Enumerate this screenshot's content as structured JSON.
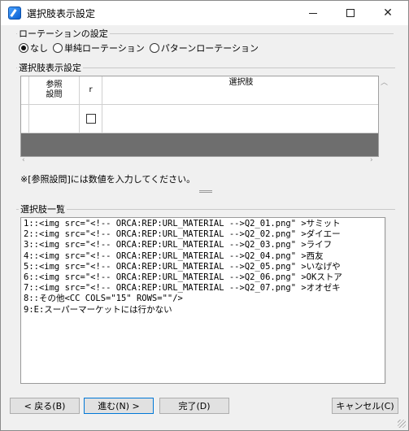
{
  "window": {
    "title": "選択肢表示設定",
    "controls": [
      "minimize-icon",
      "maximize-icon",
      "close-icon"
    ]
  },
  "rotation": {
    "label": "ローテーションの設定",
    "options": [
      {
        "label": "なし",
        "checked": true
      },
      {
        "label": "単純ローテーション",
        "checked": false
      },
      {
        "label": "パターンローテーション",
        "checked": false
      }
    ]
  },
  "choice_display": {
    "label": "選択肢表示設定",
    "columns": {
      "ref": "参照\n設問",
      "r": "r",
      "choice": "選択肢"
    },
    "rows": [
      {
        "ref": "",
        "r_checked": false,
        "choice": ""
      }
    ],
    "note": "※[参照設問]には数値を入力してください。"
  },
  "choice_list": {
    "label": "選択肢一覧",
    "lines": [
      "1::<img src=\"<!-- ORCA:REP:URL_MATERIAL -->Q2_01.png\" >サミット",
      "2::<img src=\"<!-- ORCA:REP:URL_MATERIAL -->Q2_02.png\" >ダイエー",
      "3::<img src=\"<!-- ORCA:REP:URL_MATERIAL -->Q2_03.png\" >ライフ",
      "4::<img src=\"<!-- ORCA:REP:URL_MATERIAL -->Q2_04.png\" >西友",
      "5::<img src=\"<!-- ORCA:REP:URL_MATERIAL -->Q2_05.png\" >いなげや",
      "6::<img src=\"<!-- ORCA:REP:URL_MATERIAL -->Q2_06.png\" >OKストア",
      "7::<img src=\"<!-- ORCA:REP:URL_MATERIAL -->Q2_07.png\" >オオゼキ",
      "8::その他<CC COLS=\"15\" ROWS=\"\"/>",
      "9:E:スーパーマーケットには行かない"
    ]
  },
  "buttons": {
    "back": "< 戻る(B)",
    "next": "進む(N) >",
    "done": "完了(D)",
    "cancel": "キャンセル(C)"
  }
}
